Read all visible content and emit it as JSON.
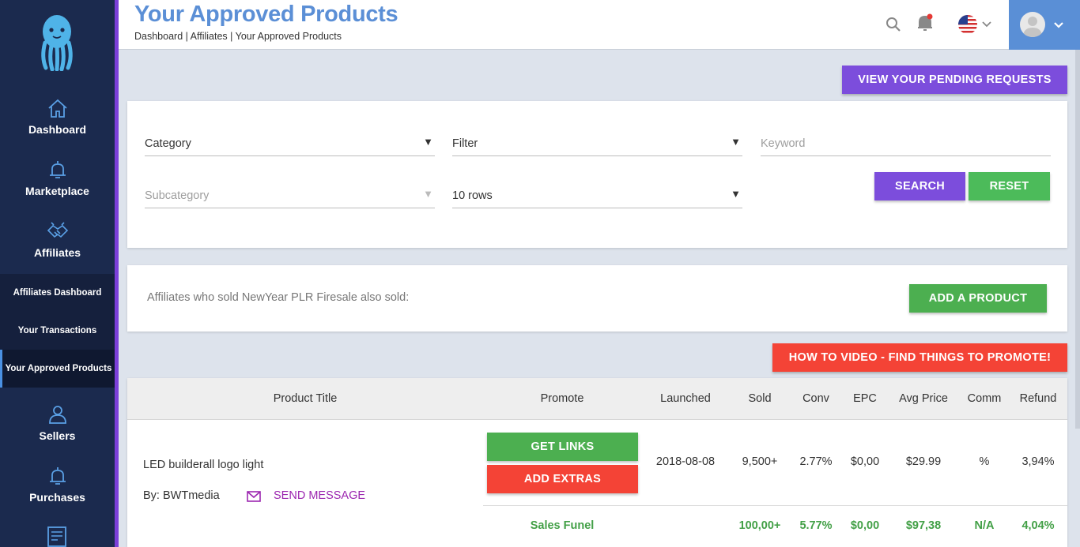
{
  "sidebar": {
    "items": [
      {
        "label": "Dashboard",
        "icon": "home-icon"
      },
      {
        "label": "Marketplace",
        "icon": "bell-icon"
      },
      {
        "label": "Affiliates",
        "icon": "handshake-icon"
      },
      {
        "label": "Sellers",
        "icon": "users-icon"
      },
      {
        "label": "Purchases",
        "icon": "bell-icon"
      }
    ],
    "sub_items": [
      {
        "label": "Affiliates Dashboard"
      },
      {
        "label": "Your Transactions"
      },
      {
        "label": "Your Approved Products"
      }
    ]
  },
  "header": {
    "title": "Your Approved Products",
    "breadcrumb": "Dashboard | Affiliates | Your Approved Products"
  },
  "buttons": {
    "pending": "VIEW YOUR PENDING REQUESTS",
    "search": "SEARCH",
    "reset": "RESET",
    "add_product": "ADD A PRODUCT",
    "how_to": "HOW TO VIDEO - FIND THINGS TO PROMOTE!",
    "get_links": "GET LINKS",
    "add_extras": "ADD EXTRAS",
    "send_message": "SEND MESSAGE"
  },
  "filters": {
    "category": "Category",
    "filter": "Filter",
    "keyword_placeholder": "Keyword",
    "subcategory_placeholder": "Subcategory",
    "rows": "10 rows"
  },
  "also_sold": "Affiliates who sold NewYear PLR Firesale also sold:",
  "table": {
    "headers": [
      "Product Title",
      "Promote",
      "Launched",
      "Sold",
      "Conv",
      "EPC",
      "Avg Price",
      "Comm",
      "Refund"
    ],
    "row": {
      "title": "LED builderall logo light",
      "by": "By: BWTmedia",
      "launched": "2018-08-08",
      "sold": "9,500+",
      "conv": "2.77%",
      "epc": "$0,00",
      "avg_price": "$29.99",
      "comm": "%",
      "refund": "3,94%"
    },
    "funnel": {
      "label": "Sales Funel",
      "sold": "100,00+",
      "conv": "5.77%",
      "epc": "$0,00",
      "avg_price": "$97,38",
      "comm": "N/A",
      "refund": "4,04%"
    }
  },
  "colors": {
    "sidebar": "#1b2a4e",
    "accent_purple": "#7c4ddc",
    "green": "#4caf50",
    "red": "#f44336",
    "title_blue": "#5b8fd6"
  }
}
